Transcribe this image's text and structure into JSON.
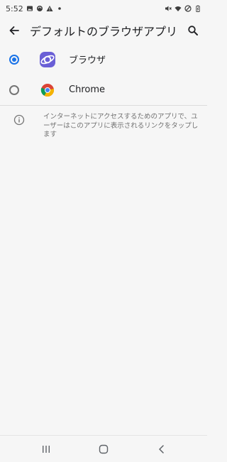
{
  "status_bar": {
    "time": "5:52",
    "left_icons": [
      "gallery-icon",
      "sync-icon",
      "warning-icon",
      "dot-icon"
    ],
    "right_icons": [
      "mute-icon",
      "wifi-icon",
      "dnd-icon",
      "battery-icon"
    ]
  },
  "app_bar": {
    "title": "デフォルトのブラウザアプリ"
  },
  "options": [
    {
      "label": "ブラウザ",
      "selected": true,
      "icon": "samsung-internet-icon"
    },
    {
      "label": "Chrome",
      "selected": false,
      "icon": "chrome-icon"
    }
  ],
  "info": {
    "text": "インターネットにアクセスするためのアプリで、ユーザーはこのアプリに表示されるリンクをタップします"
  },
  "colors": {
    "accent": "#1a73e8",
    "background": "#f6f6f6"
  }
}
